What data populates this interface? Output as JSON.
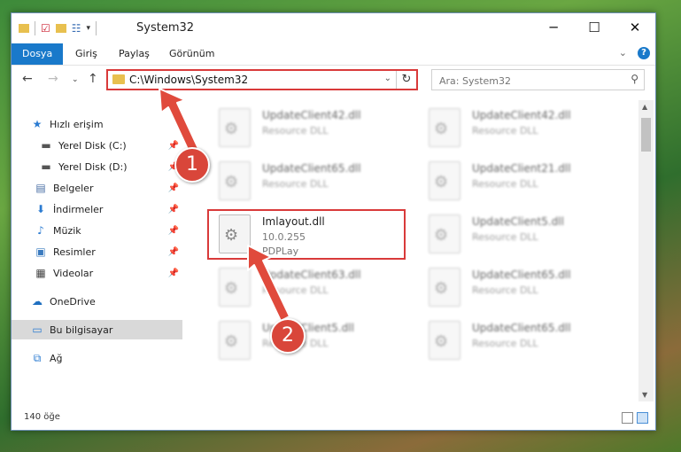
{
  "window": {
    "title": "System32",
    "controls": {
      "minimize": "─",
      "maximize": "☐",
      "close": "✕"
    }
  },
  "ribbon": {
    "tabs": [
      "Dosya",
      "Giriş",
      "Paylaş",
      "Görünüm"
    ],
    "collapse_glyph": "⌄",
    "help_glyph": "?"
  },
  "address": {
    "path": "C:\\Windows\\System32",
    "search_placeholder": "Ara: System32"
  },
  "sidebar": {
    "items": [
      {
        "label": "Hızlı erişim",
        "icon": "star-icon",
        "glyph": "★",
        "color": "#2b7bd1",
        "pinned": false
      },
      {
        "label": "Yerel Disk (C:)",
        "icon": "drive-icon",
        "glyph": "▬",
        "color": "#555555",
        "pinned": true
      },
      {
        "label": "Yerel Disk (D:)",
        "icon": "drive-icon",
        "glyph": "▬",
        "color": "#555555",
        "pinned": true
      },
      {
        "label": "Belgeler",
        "icon": "documents-icon",
        "glyph": "▤",
        "color": "#4a6fa5",
        "pinned": true
      },
      {
        "label": "İndirmeler",
        "icon": "download-icon",
        "glyph": "⬇",
        "color": "#2b7bd1",
        "pinned": true
      },
      {
        "label": "Müzik",
        "icon": "music-icon",
        "glyph": "♪",
        "color": "#2b7bd1",
        "pinned": true
      },
      {
        "label": "Resimler",
        "icon": "pictures-icon",
        "glyph": "▣",
        "color": "#3b7bbf",
        "pinned": true
      },
      {
        "label": "Videolar",
        "icon": "video-icon",
        "glyph": "▦",
        "color": "#444444",
        "pinned": true
      },
      {
        "label": "OneDrive",
        "icon": "cloud-icon",
        "glyph": "☁",
        "color": "#1f6fc0",
        "pinned": false
      },
      {
        "label": "Bu bilgisayar",
        "icon": "computer-icon",
        "glyph": "▭",
        "color": "#2b7bd1",
        "pinned": false,
        "selected": true
      },
      {
        "label": "Ağ",
        "icon": "network-icon",
        "glyph": "⧉",
        "color": "#2b7bd1",
        "pinned": false
      }
    ]
  },
  "files": [
    {
      "name": "UpdateClient42.dll",
      "line2": "Resource DLL",
      "line3": "",
      "col": 0,
      "row": 0
    },
    {
      "name": "UpdateClient42.dll",
      "line2": "Resource DLL",
      "line3": "",
      "col": 1,
      "row": 0
    },
    {
      "name": "UpdateClient65.dll",
      "line2": "Resource DLL",
      "line3": "",
      "col": 0,
      "row": 1
    },
    {
      "name": "UpdateClient21.dll",
      "line2": "Resource DLL",
      "line3": "",
      "col": 1,
      "row": 1
    },
    {
      "name": "Imlayout.dll",
      "line2": "10.0.255",
      "line3": "PDPLay",
      "col": 0,
      "row": 2,
      "highlighted": true
    },
    {
      "name": "UpdateClient5.dll",
      "line2": "Resource DLL",
      "line3": "",
      "col": 1,
      "row": 2
    },
    {
      "name": "UpdateClient63.dll",
      "line2": "Resource DLL",
      "line3": "",
      "col": 0,
      "row": 3
    },
    {
      "name": "UpdateClient65.dll",
      "line2": "Resource DLL",
      "line3": "",
      "col": 1,
      "row": 3
    },
    {
      "name": "UpdateClient5.dll",
      "line2": "Resource DLL",
      "line3": "",
      "col": 0,
      "row": 4
    },
    {
      "name": "UpdateClient65.dll",
      "line2": "Resource DLL",
      "line3": "",
      "col": 1,
      "row": 4
    }
  ],
  "status": {
    "item_count": "140 öğe"
  },
  "annotations": [
    {
      "number": "1",
      "target": "address-bar"
    },
    {
      "number": "2",
      "target": "highlighted-file"
    }
  ],
  "colors": {
    "accent": "#1979ca",
    "highlight": "#d93a3a",
    "selected_nav": "#d9d9d9"
  }
}
